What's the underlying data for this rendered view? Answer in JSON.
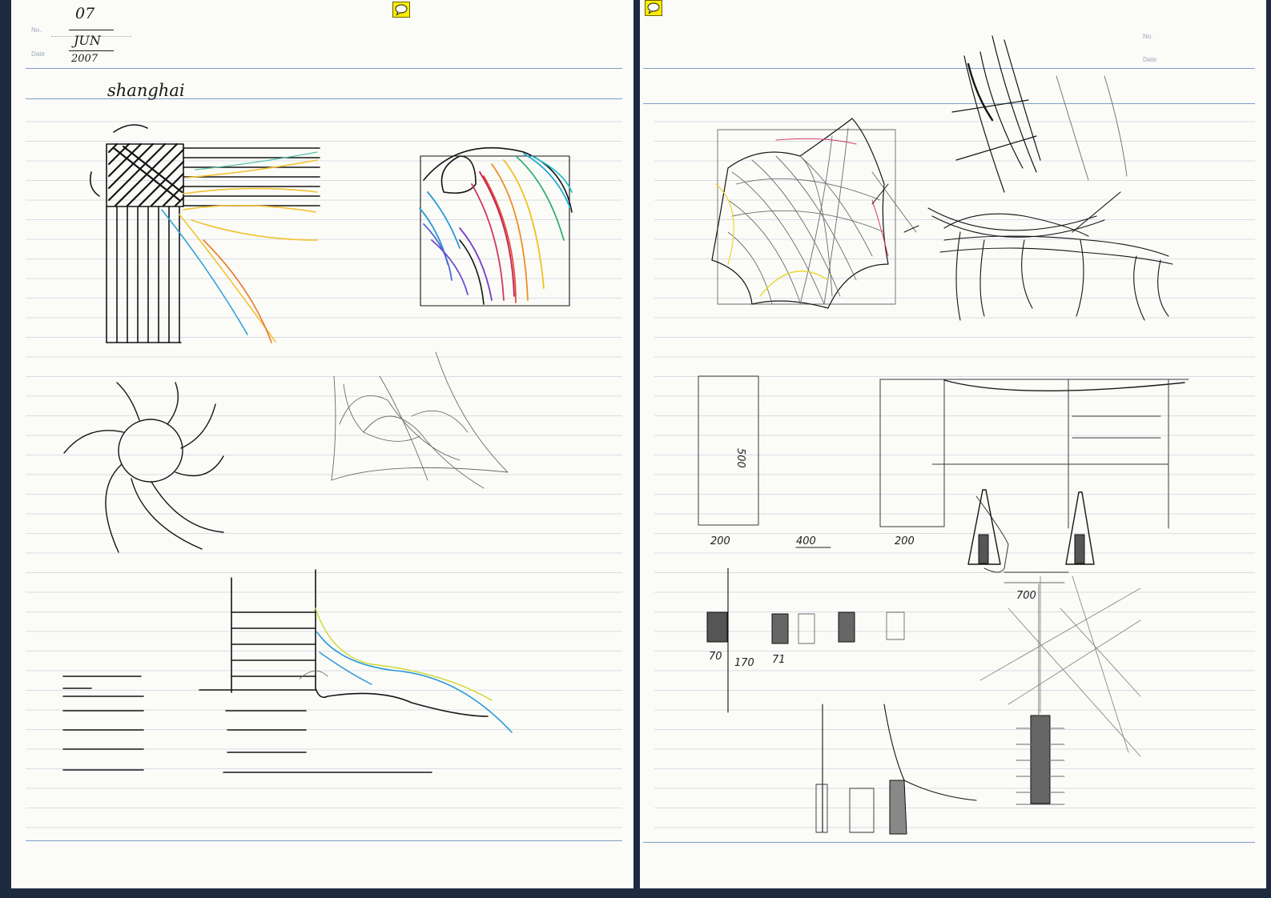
{
  "notebook": {
    "left_page": {
      "header": {
        "no_label": "No.",
        "date_label": "Date",
        "date_day": "07",
        "date_month": "JUN",
        "date_year": "2007"
      },
      "title": "shanghai"
    },
    "right_page": {
      "header": {
        "no_label": "No.",
        "date_label": "Date"
      },
      "dimensions": {
        "dim_a": "200",
        "dim_b": "400",
        "dim_c": "200",
        "dim_vertical": "500",
        "dim_span": "700",
        "dim_70": "70",
        "dim_170": "170",
        "dim_71": "71"
      }
    }
  },
  "annotations": {
    "left_icon": "comment-note-icon",
    "right_icon": "comment-note-icon",
    "color": "#ffec00"
  }
}
